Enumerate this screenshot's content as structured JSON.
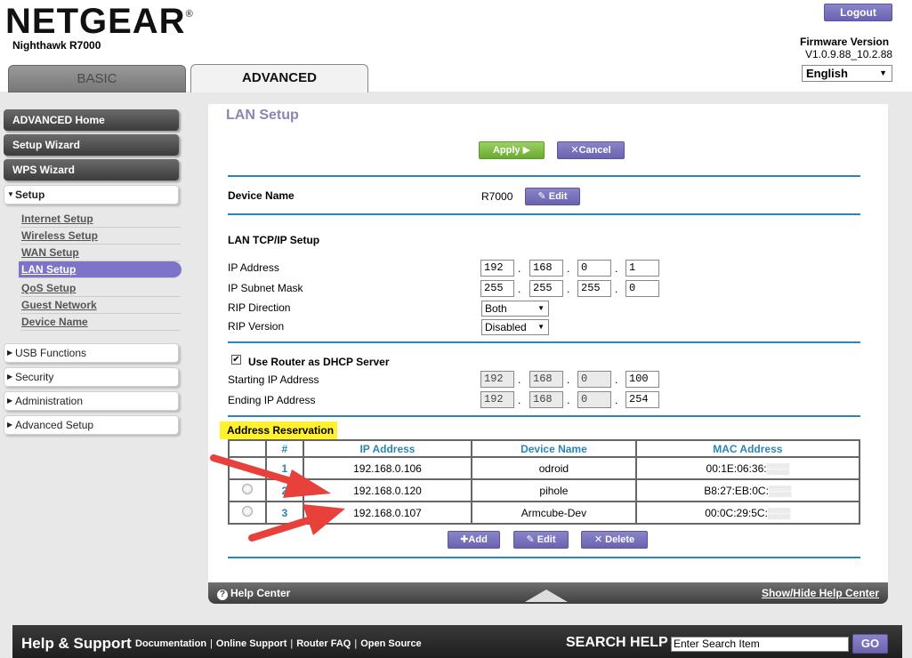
{
  "header": {
    "brand": "NETGEAR",
    "brand_mark": "®",
    "model": "Nighthawk R7000",
    "logout_label": "Logout",
    "firmware_label": "Firmware Version",
    "firmware_version": "V1.0.9.88_10.2.88",
    "language": "English"
  },
  "tabs": [
    {
      "label": "BASIC",
      "active": false
    },
    {
      "label": "ADVANCED",
      "active": true
    }
  ],
  "sidebar": {
    "top_buttons": [
      "ADVANCED Home",
      "Setup Wizard",
      "WPS Wizard"
    ],
    "setup_section": "Setup",
    "setup_items": [
      "Internet Setup",
      "Wireless Setup",
      "WAN Setup",
      "LAN Setup",
      "QoS Setup",
      "Guest Network",
      "Device Name"
    ],
    "active_item": "LAN Setup",
    "other_sections": [
      "USB Functions",
      "Security",
      "Administration",
      "Advanced Setup"
    ]
  },
  "main": {
    "title": "LAN Setup",
    "apply_label": "Apply",
    "cancel_label": "Cancel",
    "device_name_label": "Device Name",
    "device_name_value": "R7000",
    "edit_label": "Edit",
    "lan_section_title": "LAN TCP/IP Setup",
    "ip_address_label": "IP Address",
    "ip_address": [
      "192",
      "168",
      "0",
      "1"
    ],
    "subnet_label": "IP Subnet Mask",
    "subnet": [
      "255",
      "255",
      "255",
      "0"
    ],
    "rip_direction_label": "RIP Direction",
    "rip_direction_value": "Both",
    "rip_version_label": "RIP Version",
    "rip_version_value": "Disabled",
    "dhcp_label": "Use Router as DHCP Server",
    "dhcp_checked": true,
    "start_ip_label": "Starting IP Address",
    "start_ip": [
      "192",
      "168",
      "0",
      "100"
    ],
    "end_ip_label": "Ending IP Address",
    "end_ip": [
      "192",
      "168",
      "0",
      "254"
    ],
    "reservation_label": "Address Reservation",
    "table_headers": [
      "#",
      "IP Address",
      "Device Name",
      "MAC Address"
    ],
    "table_rows": [
      {
        "num": "1",
        "ip": "192.168.0.106",
        "name": "odroid",
        "mac": "00:1E:06:36:"
      },
      {
        "num": "2",
        "ip": "192.168.0.120",
        "name": "pihole",
        "mac": "B8:27:EB:0C:"
      },
      {
        "num": "3",
        "ip": "192.168.0.107",
        "name": "Armcube-Dev",
        "mac": "00:0C:29:5C:"
      }
    ],
    "add_label": "Add",
    "edit2_label": "Edit",
    "delete_label": "Delete"
  },
  "helpbar": {
    "help_center": "Help Center",
    "show_hide": "Show/Hide Help Center"
  },
  "footer": {
    "title": "Help & Support",
    "links": [
      "Documentation",
      "Online Support",
      "Router FAQ",
      "Open Source"
    ],
    "search_label": "SEARCH HELP",
    "search_placeholder": "Enter Search Item",
    "go_label": "GO"
  },
  "colors": {
    "accent_blue": "#2a86b4",
    "purple_button": "#6a63b0",
    "green_button": "#6aab2f",
    "highlight_yellow": "#fff12e",
    "arrow_red": "#e8403a"
  }
}
